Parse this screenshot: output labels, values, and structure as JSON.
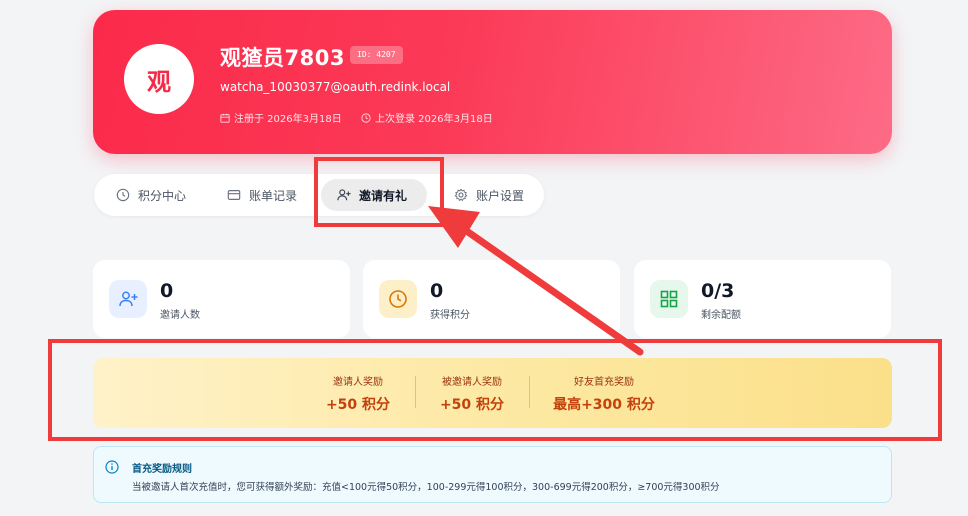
{
  "profile": {
    "avatar_char": "观",
    "username": "观猹员7803",
    "id_badge": "ID: 4207",
    "email": "watcha_10030377@oauth.redink.local",
    "registered": "注册于 2026年3月18日",
    "last_login": "上次登录 2026年3月18日"
  },
  "tabs": [
    {
      "label": "积分中心",
      "icon": "clock-icon"
    },
    {
      "label": "账单记录",
      "icon": "card-icon"
    },
    {
      "label": "邀请有礼",
      "icon": "user-plus-icon",
      "active": true
    },
    {
      "label": "账户设置",
      "icon": "gear-icon"
    }
  ],
  "stats": [
    {
      "value": "0",
      "label": "邀请人数",
      "icon": "user-plus-icon",
      "color": "#3b82f6"
    },
    {
      "value": "0",
      "label": "获得积分",
      "icon": "clock-icon",
      "color": "#d97706"
    },
    {
      "value": "0/3",
      "label": "剩余配额",
      "icon": "grid-icon",
      "color": "#16a34a"
    }
  ],
  "rewards": [
    {
      "title": "邀请人奖励",
      "value": "+50 积分"
    },
    {
      "title": "被邀请人奖励",
      "value": "+50 积分"
    },
    {
      "title": "好友首充奖励",
      "value": "最高+300 积分"
    }
  ],
  "info": {
    "title": "首充奖励规则",
    "text": "当被邀请人首次充值时，您可获得额外奖励：充值<100元得50积分，100-299元得100积分，300-699元得200积分，≥700元得300积分"
  },
  "colors": {
    "brand": "#fb2a4a",
    "annotation": "#ef3b3b"
  }
}
